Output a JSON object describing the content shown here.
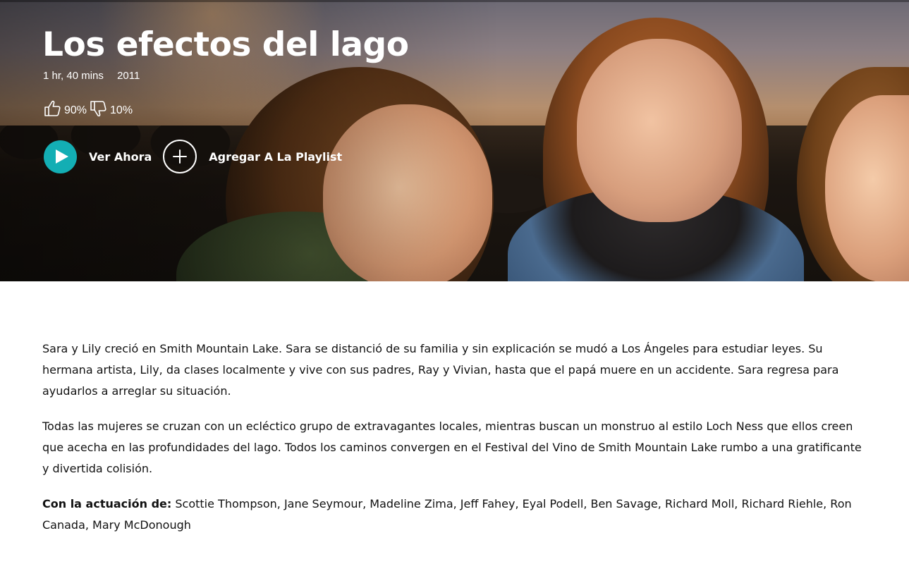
{
  "movie": {
    "title": "Los efectos del lago",
    "duration": "1 hr, 40 mins",
    "year": "2011",
    "rating": {
      "thumbs_up_icon": "thumbs-up-icon",
      "thumbs_up": "90%",
      "thumbs_down_icon": "thumbs-down-icon",
      "thumbs_down": "10%"
    }
  },
  "actions": {
    "watch_icon": "play-icon",
    "watch_label": "Ver Ahora",
    "playlist_icon": "plus-icon",
    "playlist_label": "Agregar A La Playlist"
  },
  "description": {
    "paragraph_1": "Sara y Lily creció en Smith Mountain Lake. Sara se distanció de su familia y sin explicación se mudó a Los Ángeles para estudiar leyes. Su hermana artista, Lily, da clases localmente y vive con sus padres, Ray y Vivian, hasta que el papá muere en un accidente. Sara regresa para ayudarlos a arreglar su situación.",
    "paragraph_2": "Todas las mujeres se cruzan con un ecléctico grupo de extravagantes locales, mientras buscan un monstruo al estilo Loch Ness que ellos creen que acecha en las profundidades del lago. Todos los caminos convergen en el Festival del Vino de Smith Mountain Lake rumbo a una gratificante y divertida colisión.",
    "cast_label": "Con la actuación de:",
    "cast_list": "Scottie Thompson, Jane Seymour, Madeline Zima, Jeff Fahey, Eyal Podell, Ben Savage, Richard Moll, Richard Riehle, Ron Canada, Mary McDonough"
  },
  "colors": {
    "accent": "#13aeb4",
    "hero_text": "#ffffff",
    "body_text": "#111111"
  }
}
